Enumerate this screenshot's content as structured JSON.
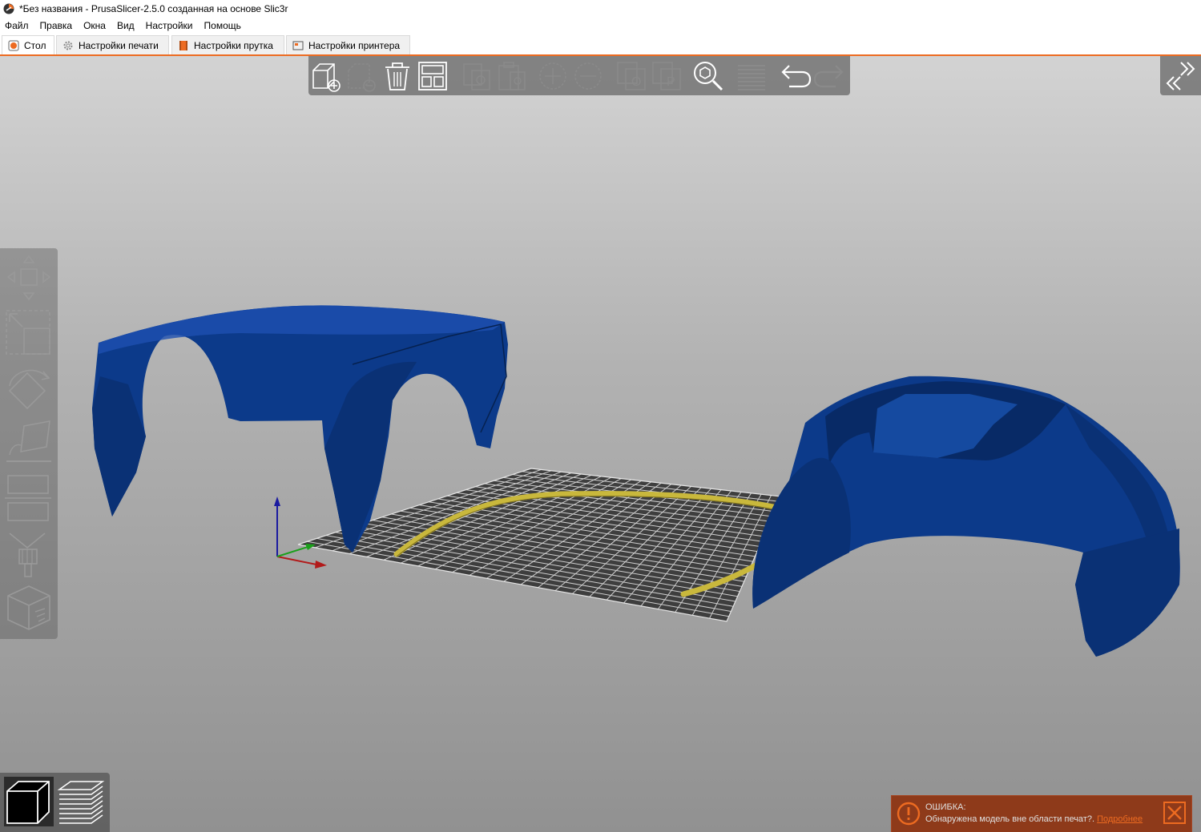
{
  "window": {
    "title": "*Без названия - PrusaSlicer-2.5.0 созданная на основе Slic3r"
  },
  "menu": [
    "Файл",
    "Правка",
    "Окна",
    "Вид",
    "Настройки",
    "Помощь"
  ],
  "tabs": [
    {
      "label": "Стол",
      "icon": "plater-icon",
      "active": true
    },
    {
      "label": "Настройки печати",
      "icon": "cog-icon",
      "active": false
    },
    {
      "label": "Настройки прутка",
      "icon": "spool-icon",
      "active": false
    },
    {
      "label": "Настройки принтера",
      "icon": "printer-icon",
      "active": false
    }
  ],
  "top_toolbar": [
    {
      "name": "add",
      "icon": "add-object-icon",
      "enabled": true
    },
    {
      "name": "delete",
      "icon": "remove-object-icon",
      "enabled": false
    },
    {
      "name": "delete_all",
      "icon": "trash-icon",
      "enabled": true
    },
    {
      "name": "arrange",
      "icon": "arrange-icon",
      "enabled": true
    },
    {
      "name": "copy",
      "icon": "copy-icon",
      "enabled": false
    },
    {
      "name": "paste",
      "icon": "paste-icon",
      "enabled": false
    },
    {
      "name": "add_instance",
      "icon": "add-instance-icon",
      "enabled": false
    },
    {
      "name": "remove_instance",
      "icon": "remove-instance-icon",
      "enabled": false
    },
    {
      "name": "split_objects",
      "icon": "split-objects-icon",
      "enabled": false
    },
    {
      "name": "split_parts",
      "icon": "split-parts-icon",
      "enabled": false
    },
    {
      "name": "search",
      "icon": "search-icon",
      "enabled": true
    },
    {
      "name": "layers",
      "icon": "layers-editing-icon",
      "enabled": false
    },
    {
      "name": "undo",
      "icon": "undo-icon",
      "enabled": true
    },
    {
      "name": "redo",
      "icon": "redo-icon",
      "enabled": false
    }
  ],
  "left_toolbar": [
    {
      "name": "move",
      "icon": "move-icon"
    },
    {
      "name": "scale",
      "icon": "scale-icon"
    },
    {
      "name": "rotate",
      "icon": "rotate-icon"
    },
    {
      "name": "place_on_face",
      "icon": "place-on-face-icon"
    },
    {
      "name": "cut",
      "icon": "cut-icon"
    },
    {
      "name": "supports_paint",
      "icon": "paint-brush-icon"
    },
    {
      "name": "seam",
      "icon": "cube-seam-icon"
    }
  ],
  "view_switch": [
    {
      "name": "3d_view",
      "icon": "cube-view-icon",
      "active": true
    },
    {
      "name": "preview",
      "icon": "layers-preview-icon",
      "active": false
    }
  ],
  "notification": {
    "title": "ОШИБКА:",
    "message": "Обнаружена модель вне области печат?.",
    "link": "Подробнее",
    "icon": "warning-icon"
  },
  "colors": {
    "accent": "#ed6b21",
    "model_blue": "#0c3a8a",
    "model_outside": "#c9b83c",
    "bed_dark": "#3e3e3e",
    "notification_bg": "#8e3a1a"
  }
}
